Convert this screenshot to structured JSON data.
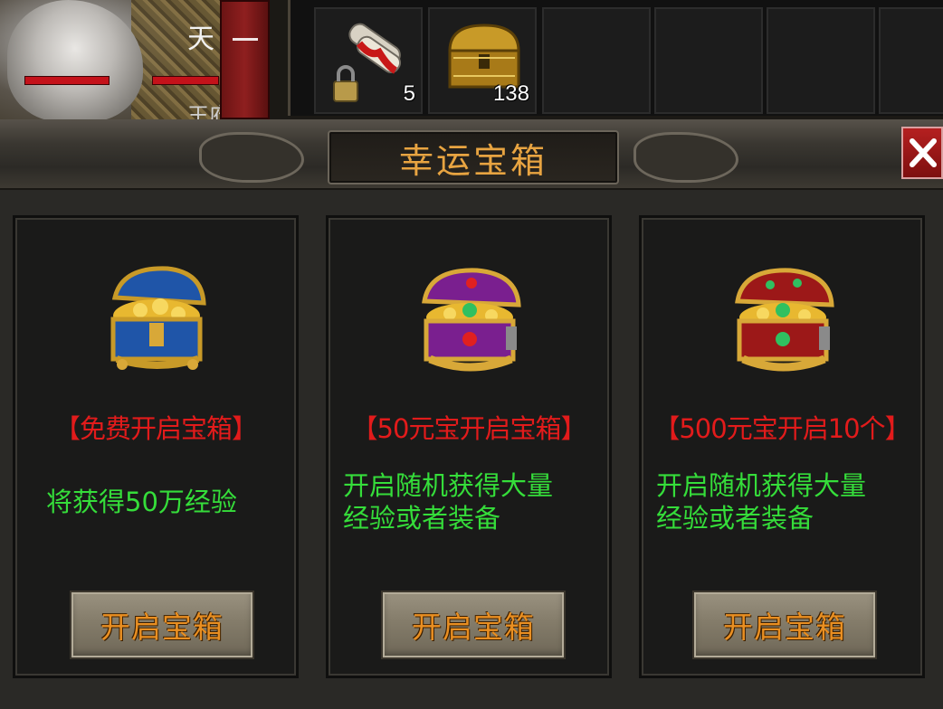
{
  "hud": {
    "player_name_char": "天",
    "player_name_char2": "王府",
    "side_tab_label": "—",
    "slots": [
      {
        "icon": "scroll-lock-icon",
        "count": "5"
      },
      {
        "icon": "treasure-chest-icon",
        "count": "138"
      },
      {
        "icon": "empty-slot",
        "count": ""
      },
      {
        "icon": "empty-slot",
        "count": ""
      },
      {
        "icon": "empty-slot",
        "count": ""
      }
    ]
  },
  "panel": {
    "title": "幸运宝箱",
    "close_label": "×",
    "cards": [
      {
        "chest_icon": "blue-treasure-chest-icon",
        "title": "【免费开启宝箱】",
        "desc_line1": "将获得50万经验",
        "desc_line2": "",
        "button": "开启宝箱"
      },
      {
        "chest_icon": "purple-treasure-chest-icon",
        "title": "【50元宝开启宝箱】",
        "desc_line1": "开启随机获得大量",
        "desc_line2": "经验或者装备",
        "button": "开启宝箱"
      },
      {
        "chest_icon": "red-treasure-chest-icon",
        "title": "【500元宝开启10个】",
        "desc_line1": "开启随机获得大量",
        "desc_line2": "经验或者装备",
        "button": "开启宝箱"
      }
    ]
  },
  "colors": {
    "title": "#e8a441",
    "card_title": "#e21b1b",
    "card_desc": "#35dd3a",
    "button_text": "#e98f22",
    "blue_chest": "#1f55a8",
    "purple_chest": "#7a1f8f",
    "red_chest": "#9c1818"
  }
}
